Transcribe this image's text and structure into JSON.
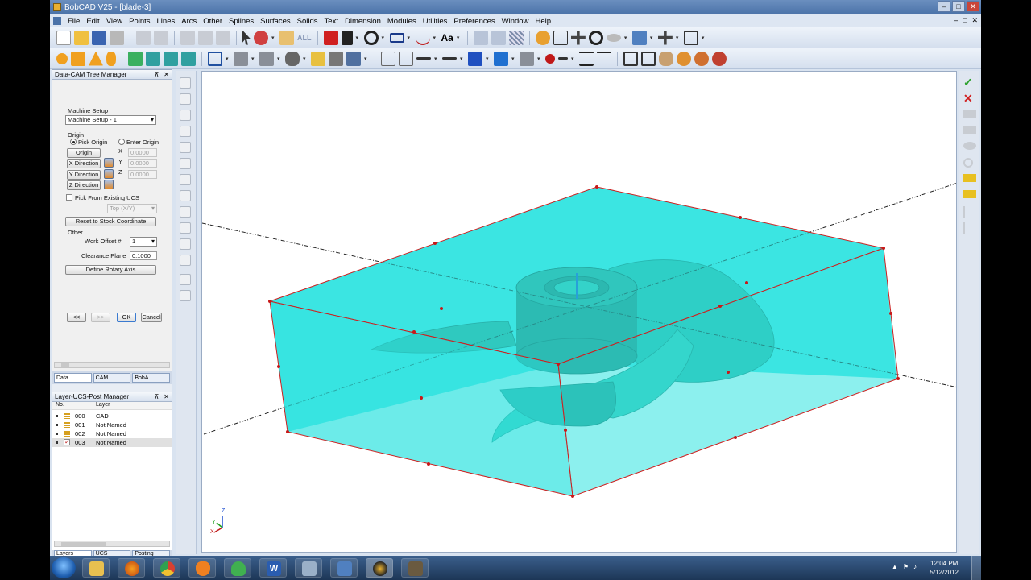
{
  "window": {
    "title": "BobCAD V25 - [blade-3]",
    "ctl_min": "–",
    "ctl_max": "□",
    "ctl_close": "✕"
  },
  "menu": [
    "File",
    "Edit",
    "View",
    "Points",
    "Lines",
    "Arcs",
    "Other",
    "Splines",
    "Surfaces",
    "Solids",
    "Text",
    "Dimension",
    "Modules",
    "Utilities",
    "Preferences",
    "Window",
    "Help"
  ],
  "toolbar": {
    "all_label": "ALL",
    "text_label": "Aa"
  },
  "datacam": {
    "title": "Data-CAM Tree Manager",
    "pin": "⊼",
    "close": "✕",
    "machine_setup_label": "Machine Setup",
    "machine_setup_value": "Machine Setup - 1",
    "origin_label": "Origin",
    "pick_origin": "Pick Origin",
    "enter_origin": "Enter Origin",
    "origin_button": "Origin",
    "x_dir": "X Direction",
    "y_dir": "Y Direction",
    "z_dir": "Z Direction",
    "x_label": "X",
    "y_label": "Y",
    "z_label": "Z",
    "x_val": "0.0000",
    "y_val": "0.0000",
    "z_val": "0.0000",
    "pick_existing_ucs": "Pick From Existing UCS",
    "ucs_value": "Top (X/Y)",
    "reset_stock": "Reset to Stock Coordinate",
    "other_label": "Other",
    "work_offset_label": "Work Offset #",
    "work_offset_value": "1",
    "clearance_label": "Clearance Plane",
    "clearance_value": "0.1000",
    "define_rotary": "Define Rotary Axis",
    "back_button": "<<",
    "next_button": ">>",
    "ok_button": "OK",
    "cancel_button": "Cancel",
    "tabs": [
      "Data...",
      "CAM...",
      "BobA..."
    ]
  },
  "layers": {
    "title": "Layer-UCS-Post Manager",
    "col_no": "No.",
    "col_layer": "Layer",
    "rows": [
      {
        "no": "000",
        "name": "CAD"
      },
      {
        "no": "001",
        "name": "Not Named"
      },
      {
        "no": "002",
        "name": "Not Named"
      },
      {
        "no": "003",
        "name": "Not Named"
      }
    ],
    "tabs": [
      "Layers",
      "UCS",
      "Posting"
    ]
  },
  "viewport": {
    "axis_z": "Z",
    "axis_x": "X",
    "axis_y": "Y"
  },
  "colors": {
    "stock": "#2ee3e0",
    "stock_edge": "#cc2020",
    "blade": "#3bb7a7",
    "hub": "#2b8f80"
  },
  "taskbar": {
    "time": "12:04 PM",
    "date": "5/12/2012",
    "word_label": "W"
  }
}
